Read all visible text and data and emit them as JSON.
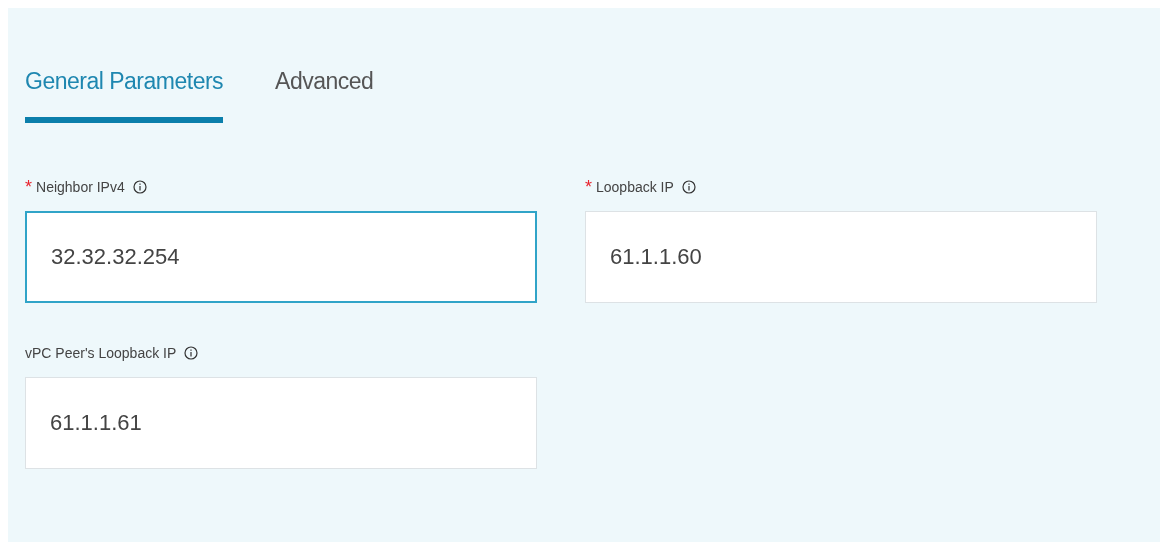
{
  "tabs": [
    {
      "label": "General Parameters",
      "selected": true
    },
    {
      "label": "Advanced",
      "selected": false
    }
  ],
  "fields": [
    {
      "required_mark": "*",
      "label": "Neighbor IPv4",
      "value": "32.32.32.254",
      "focused": true
    },
    {
      "required_mark": "*",
      "label": "Loopback IP",
      "value": "61.1.1.60",
      "focused": false
    },
    {
      "label": "vPC Peer's Loopback IP",
      "value": "61.1.1.61",
      "focused": false
    }
  ]
}
